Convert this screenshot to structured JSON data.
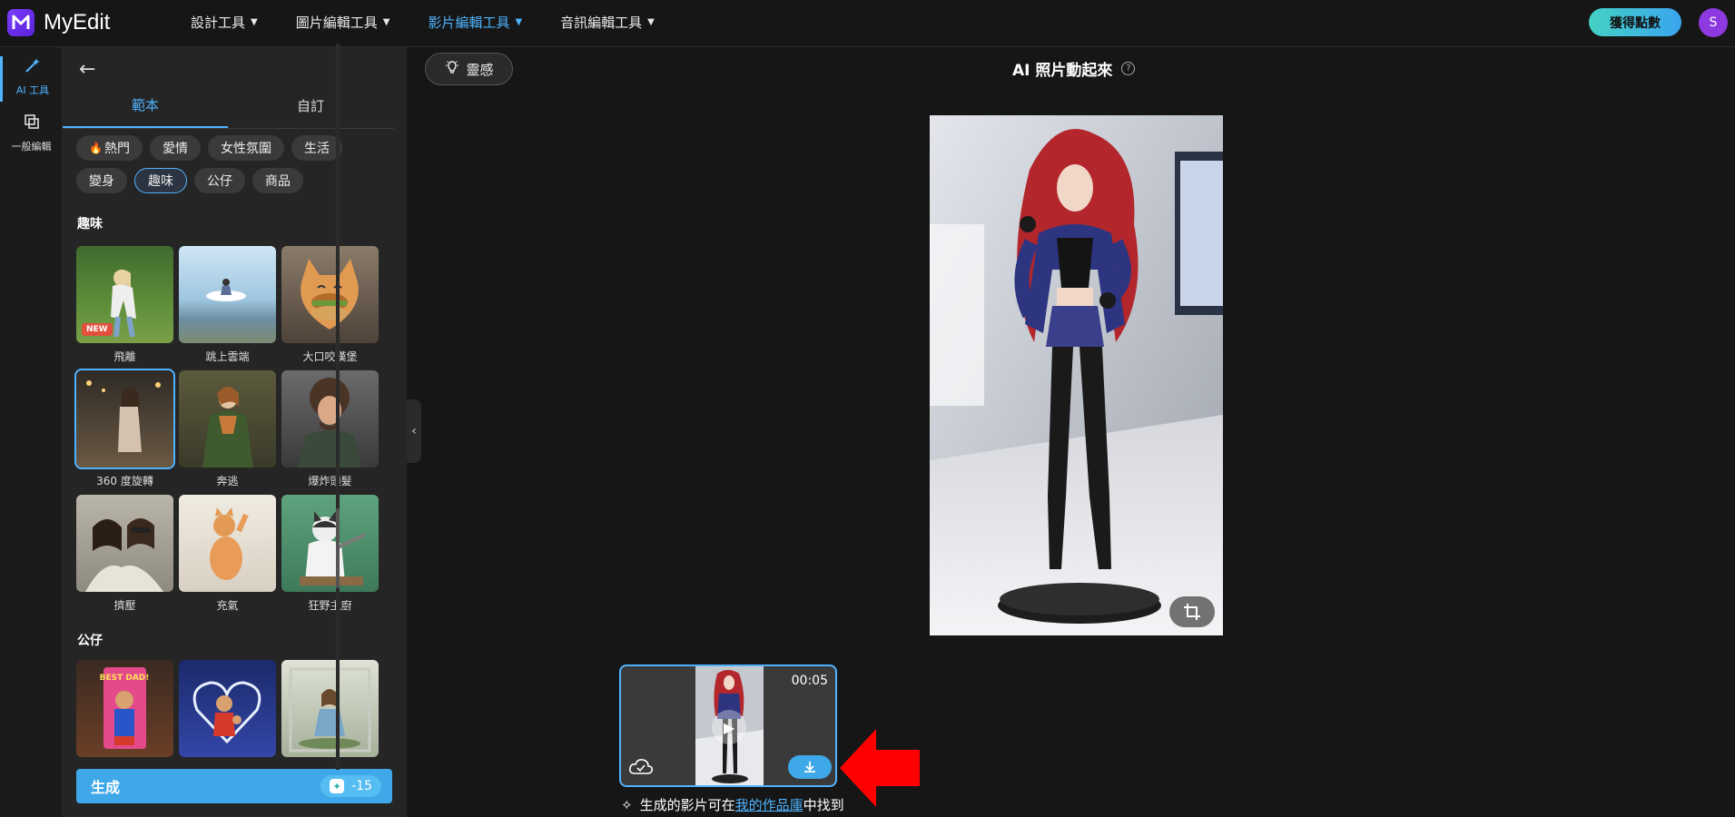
{
  "app": {
    "name": "MyEdit",
    "avatar_initial": "S",
    "points_button": "獲得點數"
  },
  "nav": [
    {
      "label": "設計工具"
    },
    {
      "label": "圖片編輯工具"
    },
    {
      "label": "影片編輯工具",
      "active": true
    },
    {
      "label": "音訊編輯工具"
    }
  ],
  "rail": [
    {
      "label": "AI 工具",
      "icon": "magic-wand-icon"
    },
    {
      "label": "一般編輯",
      "icon": "layers-icon"
    }
  ],
  "panel": {
    "tabs": [
      {
        "label": "範本"
      },
      {
        "label": "自訂"
      }
    ],
    "chips_row1": [
      "熱門",
      "愛情",
      "女性氛圍",
      "生活"
    ],
    "chips_row2": [
      "變身",
      "趣味",
      "公仔",
      "商品"
    ],
    "hot_icon": "🔥",
    "section_fun": "趣味",
    "fun_items": [
      "飛離",
      "跳上雲端",
      "大口咬漢堡",
      "360 度旋轉",
      "奔逃",
      "爆炸頭髮",
      "擠壓",
      "充氣",
      "狂野主廚"
    ],
    "new_badge": "NEW",
    "section_figure": "公仔",
    "figure_items": [
      "",
      "",
      ""
    ],
    "best_dad_text": "BEST DAD!",
    "generate_label": "生成",
    "generate_cost": "-15"
  },
  "main": {
    "inspire_label": "靈感",
    "title": "AI 照片動起來",
    "help": "?",
    "video_duration": "00:05",
    "note_prefix": "生成的影片可在",
    "note_link": "我的作品庫",
    "note_suffix": "中找到"
  },
  "colors": {
    "accent": "#4fb3ff",
    "brand": "#7b3cff",
    "arrow": "#ff0000"
  }
}
